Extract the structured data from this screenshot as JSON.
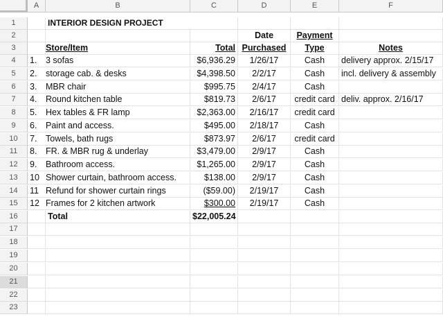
{
  "columns": [
    "A",
    "B",
    "C",
    "D",
    "E",
    "F"
  ],
  "row_numbers": [
    "1",
    "2",
    "3",
    "4",
    "5",
    "6",
    "7",
    "8",
    "9",
    "10",
    "11",
    "12",
    "13",
    "14",
    "15",
    "16",
    "17",
    "18",
    "19",
    "20",
    "21",
    "22",
    "23"
  ],
  "title": "INTERIOR DESIGN PROJECT",
  "headers": {
    "date_line1": "Date",
    "payment_line1": "Payment",
    "store_item": "Store/Item",
    "total": "Total",
    "date_line2": "Purchased",
    "payment_line2": "Type",
    "notes": "Notes"
  },
  "items": [
    {
      "num": "1.",
      "item": "3 sofas",
      "total": "$6,936.29",
      "date": "1/26/17",
      "type": "Cash",
      "notes": "delivery approx. 2/15/17"
    },
    {
      "num": "2.",
      "item": "storage cab. & desks",
      "total": "$4,398.50",
      "date": "2/2/17",
      "type": "Cash",
      "notes": "incl. delivery & assembly"
    },
    {
      "num": "3.",
      "item": "MBR chair",
      "total": "$995.75",
      "date": "2/4/17",
      "type": "Cash",
      "notes": ""
    },
    {
      "num": "4.",
      "item": "Round kitchen table",
      "total": "$819.73",
      "date": "2/6/17",
      "type": "credit card",
      "notes": "deliv. approx. 2/16/17"
    },
    {
      "num": "5.",
      "item": "Hex tables & FR lamp",
      "total": "$2,363.00",
      "date": "2/16/17",
      "type": "credit card",
      "notes": ""
    },
    {
      "num": "6.",
      "item": "Paint and access.",
      "total": "$495.00",
      "date": "2/18/17",
      "type": "Cash",
      "notes": ""
    },
    {
      "num": "7.",
      "item": "Towels, bath rugs",
      "total": "$873.97",
      "date": "2/6/17",
      "type": "credit card",
      "notes": ""
    },
    {
      "num": "8.",
      "item": "FR. & MBR rug & underlay",
      "total": "$3,479.00",
      "date": "2/9/17",
      "type": "Cash",
      "notes": ""
    },
    {
      "num": "9.",
      "item": "Bathroom access.",
      "total": "$1,265.00",
      "date": "2/9/17",
      "type": "Cash",
      "notes": ""
    },
    {
      "num": "10",
      "item": "Shower curtain, bathroom access.",
      "total": "$138.00",
      "date": "2/9/17",
      "type": "Cash",
      "notes": ""
    },
    {
      "num": "11",
      "item": "Refund for shower curtain rings",
      "total": "($59.00)",
      "date": "2/19/17",
      "type": "Cash",
      "notes": ""
    },
    {
      "num": "12",
      "item": "Frames for 2 kitchen artwork",
      "total": "$300.00",
      "date": "2/19/17",
      "type": "Cash",
      "notes": ""
    }
  ],
  "total_label": "Total",
  "grand_total": "$22,005.24"
}
